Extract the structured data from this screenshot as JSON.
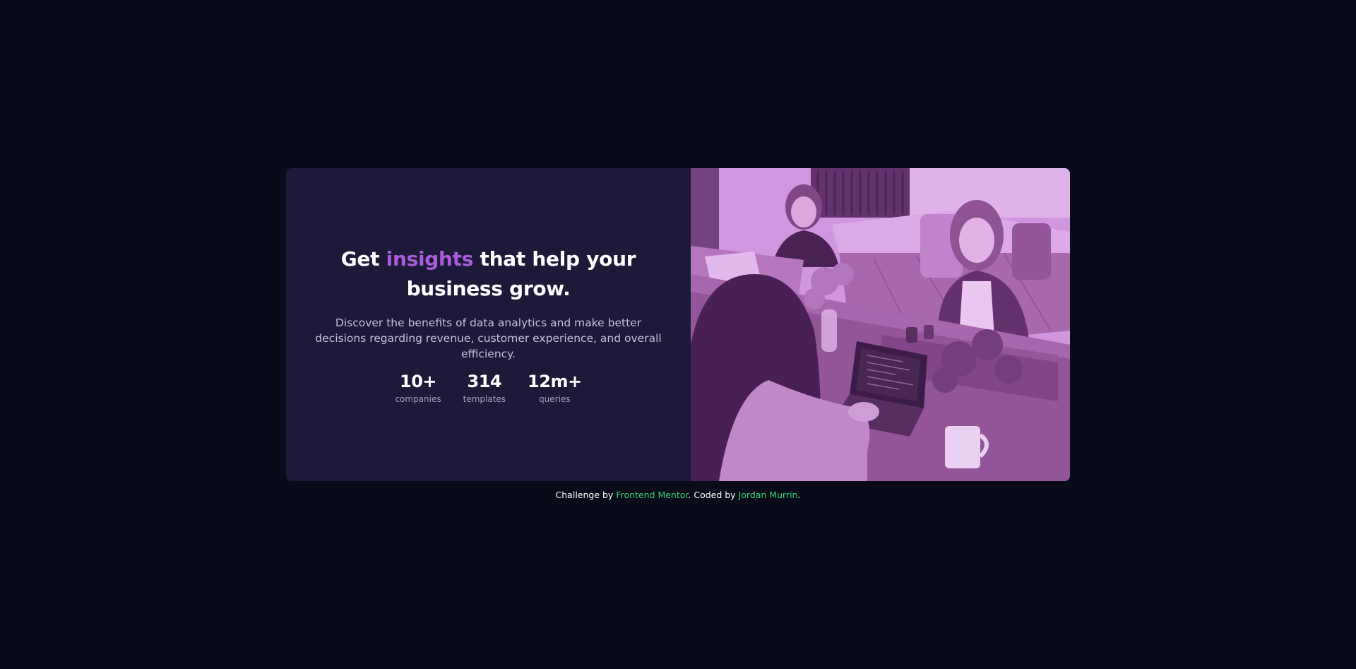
{
  "hero": {
    "title_before": "Get ",
    "title_highlight": "insights",
    "title_after": " that help your business grow.",
    "description": "Discover the benefits of data analytics and make better decisions regarding revenue, customer experience, and overall efficiency.",
    "image_alt": "Three women working on laptops in an office"
  },
  "stats": [
    {
      "value": "10+",
      "label": "companies"
    },
    {
      "value": "314",
      "label": "templates"
    },
    {
      "value": "12m+",
      "label": "queries"
    }
  ],
  "attribution": {
    "prefix": "Challenge by ",
    "challenge_link": "Frontend Mentor",
    "middle": ". Coded by ",
    "author_link": "Jordan Murrin",
    "suffix": "."
  },
  "colors": {
    "background": "#090b1a",
    "card": "#1c1a38",
    "accent": "#aa5cdb",
    "link": "#3ad26e",
    "image_tint": "#d9a0e0"
  }
}
